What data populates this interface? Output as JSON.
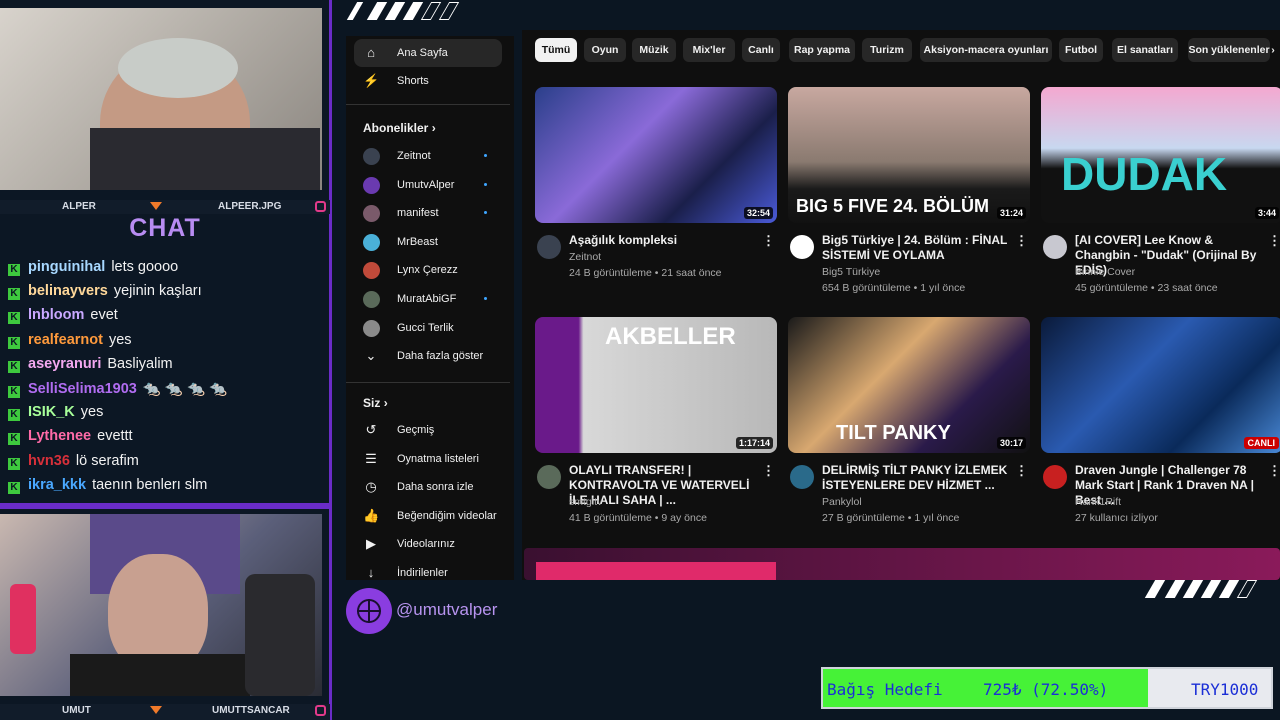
{
  "cams": {
    "top": {
      "left_label": "ALPER",
      "right_label": "ALPEER.JPG"
    },
    "bottom": {
      "left_label": "UMUT",
      "right_label": "UMUTTSANCAR"
    }
  },
  "chat": {
    "title": "CHAT",
    "messages": [
      {
        "user": "pinguinihal",
        "text": "lets goooo",
        "color": "#a8d8ff"
      },
      {
        "user": "belinayvers",
        "text": "yejinin kaşları",
        "color": "#ffd89a"
      },
      {
        "user": "lnbloom",
        "text": "evet",
        "color": "#c9a8ff"
      },
      {
        "user": "realfearnot",
        "text": "yes",
        "color": "#ff9a3c"
      },
      {
        "user": "aseyranuri",
        "text": "Basliyalim",
        "color": "#f3a8f0"
      },
      {
        "user": "SelliSelima1903",
        "text": "🐀 🐀 🐀 🐀",
        "color": "#b06cf0"
      },
      {
        "user": "ISIK_K",
        "text": "yes",
        "color": "#a8ff9a"
      },
      {
        "user": "Lythenee",
        "text": "evettt",
        "color": "#ff6ba8"
      },
      {
        "user": "hvn36",
        "text": "lö serafim",
        "color": "#d8303a"
      },
      {
        "user": "ikra_kkk",
        "text": "taenın benlerı slm",
        "color": "#4aa8ff"
      }
    ]
  },
  "sidebar": {
    "home": "Ana Sayfa",
    "shorts": "Shorts",
    "subscriptions_header": "Abonelikler",
    "subscriptions": [
      {
        "name": "Zeitnot",
        "color": "#3a4250",
        "dot": true
      },
      {
        "name": "UmutvAlper",
        "color": "#6a3ab0",
        "dot": true
      },
      {
        "name": "manifest",
        "color": "#7a5a6a",
        "dot": true
      },
      {
        "name": "MrBeast",
        "color": "#4ab0d8",
        "dot": false
      },
      {
        "name": "Lynx Çerezz",
        "color": "#c04a3a",
        "dot": false
      },
      {
        "name": "MuratAbiGF",
        "color": "#5a6a5a",
        "dot": true
      },
      {
        "name": "Gucci Terlik",
        "color": "#8a8a8a",
        "dot": false
      }
    ],
    "show_more": "Daha fazla göster",
    "you_header": "Siz",
    "you_items": [
      {
        "label": "Geçmiş",
        "icon": "history-icon",
        "glyph": "↺"
      },
      {
        "label": "Oynatma listeleri",
        "icon": "playlist-icon",
        "glyph": "☰"
      },
      {
        "label": "Daha sonra izle",
        "icon": "clock-icon",
        "glyph": "◷"
      },
      {
        "label": "Beğendiğim videolar",
        "icon": "like-icon",
        "glyph": "👍"
      },
      {
        "label": "Videolarınız",
        "icon": "your-videos-icon",
        "glyph": "▶"
      },
      {
        "label": "İndirilenler",
        "icon": "download-icon",
        "glyph": "↓"
      }
    ]
  },
  "chips": [
    "Tümü",
    "Oyun",
    "Müzik",
    "Mix'ler",
    "Canlı",
    "Rap yapma",
    "Turizm",
    "Aksiyon-macera oyunları",
    "Futbol",
    "El sanatları",
    "Son yüklenenler"
  ],
  "videos": [
    {
      "title": "Aşağılık kompleksi",
      "channel": "Zeitnot",
      "meta": "24 B görüntüleme • 21 saat önce",
      "duration": "32:54",
      "live": "",
      "thumb_bg": "linear-gradient(135deg,#2a3f8a 0%,#8a6ad8 40%,#1a1f4a 70%,#4a5ad8 100%)",
      "thumb_text": "",
      "avatar": "#3a4250"
    },
    {
      "title": "Big5 Türkiye | 24. Bölüm : FİNAL SİSTEMİ VE OYLAMA",
      "channel": "Big5 Türkiye",
      "meta": "654 B görüntüleme • 1 yıl önce",
      "duration": "31:24",
      "live": "",
      "thumb_bg": "linear-gradient(180deg,#c8a8a0 0%,#8a7a70 55%,#1a1a1a 75%,#111 100%)",
      "thumb_text": "BIG 5 FIVE 24. BÖLÜM",
      "avatar": "#ffffff"
    },
    {
      "title": "[AI COVER] Lee Know & Changbin - \"Dudak\" (Orijinal By EDİS)",
      "channel": "Binnie Cover",
      "meta": "45 görüntüleme • 23 saat önce",
      "duration": "3:44",
      "live": "",
      "thumb_bg": "linear-gradient(180deg,#f4a8d0 0%,#c8d8f0 45%,#111 60%,#111 100%)",
      "thumb_text": "DUDAK",
      "avatar": "#c8c8d0"
    },
    {
      "title": "OLAYLI TRANSFER! | KONTRAVOLTA VE WATERVELİ İLE HALI SAHA | ...",
      "channel": "smtgltv",
      "meta": "41 B görüntüleme • 9 ay önce",
      "duration": "1:17:14",
      "live": "",
      "thumb_bg": "linear-gradient(90deg,#6a1a8a 0%,#6a1a8a 18%,#d8d8d8 20%,#b8b8b8 100%)",
      "thumb_text": "AKBELLER",
      "avatar": "#5a6a5a"
    },
    {
      "title": "DELİRMİŞ TİLT PANKY İZLEMEK İSTEYENLERE DEV HİZMET ...",
      "channel": "Pankylol",
      "meta": "27 B görüntüleme • 1 yıl önce",
      "duration": "30:17",
      "live": "",
      "thumb_bg": "linear-gradient(135deg,#1a1a1a 0%,#d8a870 40%,#2a1a4a 70%,#111 100%)",
      "thumb_text": "TILT PANKY",
      "avatar": "#2a6a8a"
    },
    {
      "title": "Draven Jungle | Challenger 78 Mark Start | Rank 1 Draven NA | Best ...",
      "channel": "Rank1Rift",
      "meta": "27 kullanıcı izliyor",
      "duration": "",
      "live": "CANLI",
      "thumb_bg": "linear-gradient(135deg,#0a1a3a 0%,#2a5ab0 40%,#0a2a5a 70%,#4a8ad8 100%)",
      "thumb_text": "",
      "avatar": "#c82020"
    }
  ],
  "handle": "@umutvalper",
  "donation": {
    "label": "Bağış Hedefi",
    "amount": "725₺ (72.50%)",
    "target": "TRY1000",
    "progress": 0.725
  }
}
